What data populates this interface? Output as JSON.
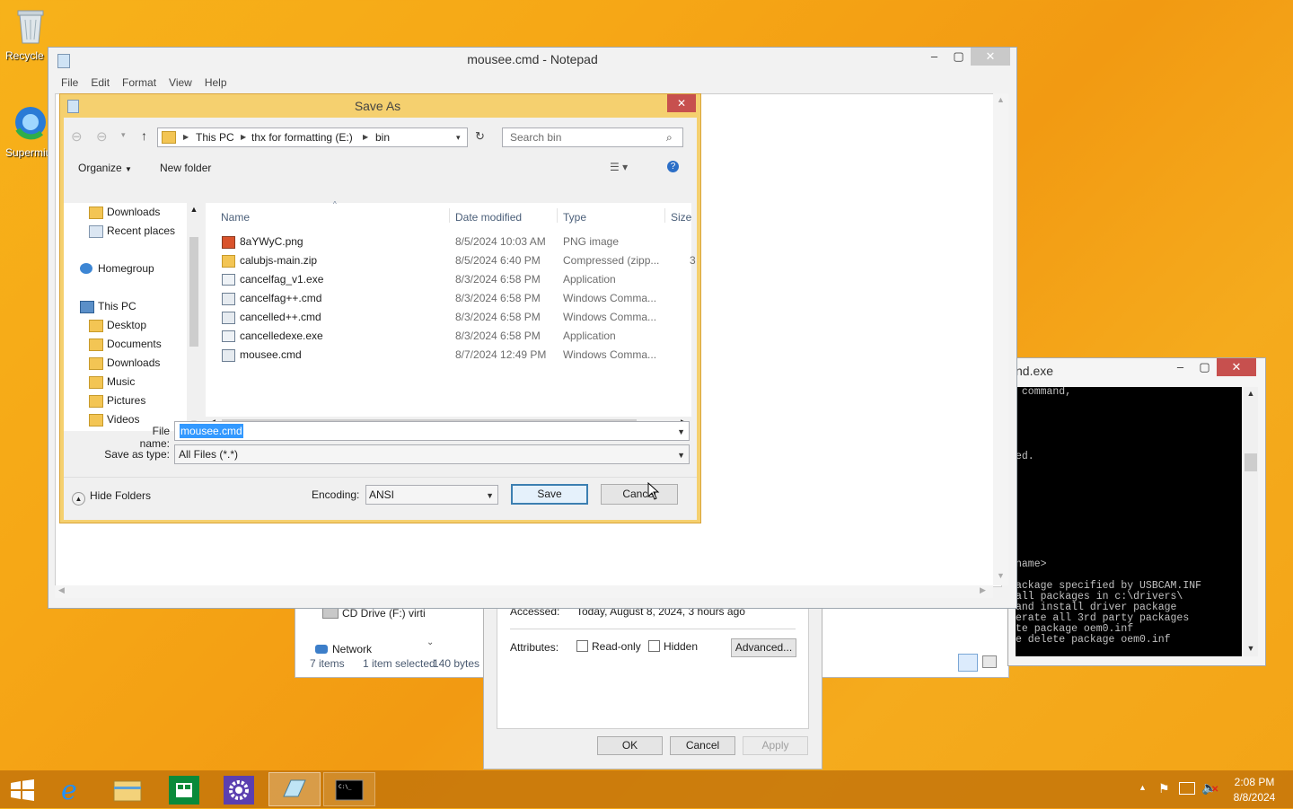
{
  "desktop": {
    "icons": [
      {
        "label": "Recycle Bin",
        "icon": "recycle-bin-icon"
      },
      {
        "label": "Supermium",
        "icon": "browser-icon"
      }
    ]
  },
  "notepad": {
    "title": "mousee.cmd - Notepad",
    "menu": [
      "File",
      "Edit",
      "Format",
      "View",
      "Help"
    ]
  },
  "save_as": {
    "title": "Save As",
    "breadcrumb": [
      "This PC",
      "thx for formatting (E:)",
      "bin"
    ],
    "search_placeholder": "Search bin",
    "toolbar": {
      "organize": "Organize",
      "new_folder": "New folder"
    },
    "nav": {
      "favorites": [
        "Downloads",
        "Recent places"
      ],
      "homegroup": "Homegroup",
      "this_pc": "This PC",
      "pc_items": [
        "Desktop",
        "Documents",
        "Downloads",
        "Music",
        "Pictures",
        "Videos"
      ]
    },
    "columns": {
      "name": "Name",
      "date": "Date modified",
      "type": "Type",
      "size": "Size"
    },
    "files": [
      {
        "name": "8aYWyC.png",
        "date": "8/5/2024 10:03 AM",
        "type": "PNG image"
      },
      {
        "name": "calubjs-main.zip",
        "date": "8/5/2024 6:40 PM",
        "type": "Compressed (zipp..."
      },
      {
        "name": "cancelfag_v1.exe",
        "date": "8/3/2024 6:58 PM",
        "type": "Application"
      },
      {
        "name": "cancelfag++.cmd",
        "date": "8/3/2024 6:58 PM",
        "type": "Windows Comma..."
      },
      {
        "name": "cancelled++.cmd",
        "date": "8/3/2024 6:58 PM",
        "type": "Windows Comma..."
      },
      {
        "name": "cancelledexe.exe",
        "date": "8/3/2024 6:58 PM",
        "type": "Application"
      },
      {
        "name": "mousee.cmd",
        "date": "8/7/2024 12:49 PM",
        "type": "Windows Comma..."
      }
    ],
    "size_fragment": "3",
    "file_name_label": "File name:",
    "file_name_value": "mousee.cmd",
    "save_type_label": "Save as type:",
    "save_type_value": "All Files  (*.*)",
    "hide_folders": "Hide Folders",
    "encoding_label": "Encoding:",
    "encoding_value": "ANSI",
    "save_btn": "Save",
    "cancel_btn": "Cancel"
  },
  "bg_explorer": {
    "drive": "CD Drive (F:) virti",
    "network": "Network",
    "items_count": "7 items",
    "selected": "1 item selected",
    "bytes": "140 bytes"
  },
  "properties": {
    "accessed_label": "Accessed:",
    "accessed_value": "Today, August 8, 2024, 3 hours ago",
    "attributes_label": "Attributes:",
    "readonly": "Read-only",
    "hidden": "Hidden",
    "advanced": "Advanced...",
    "ok": "OK",
    "cancel": "Cancel",
    "apply": "Apply"
  },
  "cmd": {
    "title": "nd.exe",
    "lines": [
      " command,",
      "",
      "",
      "",
      "",
      "",
      "ed.",
      "",
      "",
      "",
      "",
      "",
      "",
      "",
      "",
      "",
      "name>",
      "",
      "ackage specified by USBCAM.INF",
      "all packages in c:\\drivers\\",
      "and install driver package",
      "erate all 3rd party packages",
      "te package oem0.inf",
      "e delete package oem0.inf"
    ]
  },
  "taskbar": {
    "time": "2:08 PM",
    "date": "8/8/2024"
  },
  "colors": {
    "desktop": "#f5a916",
    "dialog_frame": "#f5d06f",
    "selection": "#3399ff",
    "close_red": "#c7504e"
  }
}
